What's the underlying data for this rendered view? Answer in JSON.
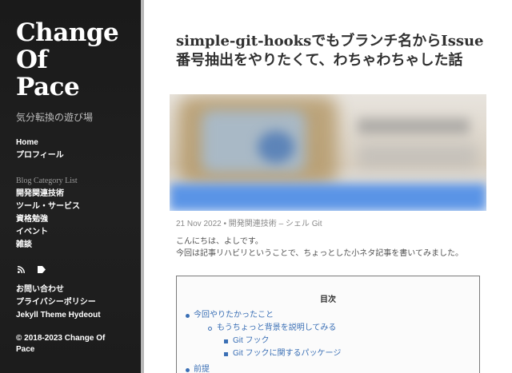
{
  "sidebar": {
    "title_lines": [
      "Change",
      "Of",
      "Pace"
    ],
    "tagline": "気分転換の遊び場",
    "nav_primary": [
      "Home",
      "プロフィール"
    ],
    "category_heading": "Blog Category List",
    "categories": [
      "開発関連技術",
      "ツール・サービス",
      "資格勉強",
      "イベント",
      "雑談"
    ],
    "icons": [
      "rss-icon",
      "tag-icon"
    ],
    "nav_secondary": [
      "お問い合わせ",
      "プライバシーポリシー",
      "Jekyll Theme Hydeout"
    ],
    "copyright": "© 2018-2023 Change Of Pace"
  },
  "post": {
    "title": "simple-git-hooksでもブランチ名からIssue番号抽出をやりたくて、わちゃわちゃした話",
    "date": "21 Nov 2022",
    "separator": "•",
    "category": "開発関連技術",
    "dash": "–",
    "tags": "シェル Git",
    "intro_lines": [
      "こんにちは、よしです。",
      "今回は記事リハビリということで、ちょっとした小ネタ記事を書いてみました。"
    ]
  },
  "toc": {
    "title": "目次",
    "items": [
      {
        "level": 1,
        "label": "今回やりたかったこと"
      },
      {
        "level": 2,
        "label": "もうちょっと背景を説明してみる"
      },
      {
        "level": 3,
        "label": "Git フック"
      },
      {
        "level": 3,
        "label": "Git フックに関するパッケージ"
      },
      {
        "level": 1,
        "label": "前提"
      }
    ]
  },
  "colors": {
    "sidebar_bg": "#1f1f1f",
    "link": "#3a6fb5",
    "text": "#515151"
  }
}
